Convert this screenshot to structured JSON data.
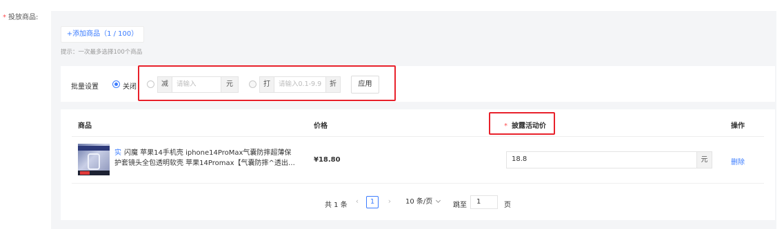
{
  "form": {
    "required_mark": "*",
    "label": "投放商品:"
  },
  "add_product": {
    "label": "+添加商品（1 / 100）",
    "hint": "提示：一次最多选择100个商品"
  },
  "batch": {
    "label": "批量设置",
    "options": {
      "off": "关闭",
      "reduce_prefix": "减",
      "reduce_placeholder": "请输入",
      "reduce_unit": "元",
      "discount_prefix": "打",
      "discount_placeholder": "请输入0.1-9.9",
      "discount_unit": "折"
    },
    "selected": "off",
    "apply_label": "应用"
  },
  "table": {
    "headers": {
      "product": "商品",
      "price": "价格",
      "activity_price_mark": "*",
      "activity_price": "披露活动价",
      "action": "操作"
    },
    "rows": [
      {
        "tag": "实",
        "name": "闪魔 苹果14手机壳 iphone14ProMax气囊防摔超薄保护套镜头全包透明软壳 苹果14Promax【气囊防摔^透出…",
        "price": "¥18.80",
        "activity_price": "18.8",
        "unit": "元",
        "action": "删除"
      }
    ]
  },
  "pagination": {
    "total": "共 1 条",
    "prev": "‹",
    "current": "1",
    "next": "›",
    "page_size": "10 条/页",
    "jump_label": "跳至",
    "jump_value": "1",
    "page_unit": "页"
  },
  "colors": {
    "accent": "#3b7cff",
    "required": "#ff4d4f",
    "highlight": "#e8202a",
    "panel_bg": "#f4f5f7"
  }
}
